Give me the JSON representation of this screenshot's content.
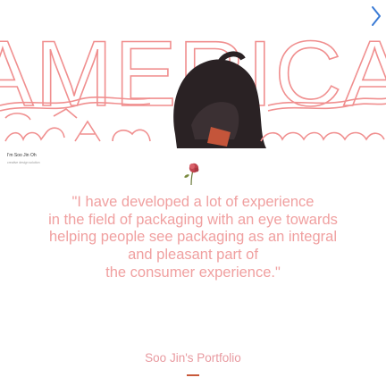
{
  "hero": {
    "title": "AMERICA",
    "nav_icon": "chevron-right-icon"
  },
  "intro": {
    "name": "I'm Soo Jin Oh",
    "tagline": "creative design solution"
  },
  "quote": {
    "lines": [
      "\"I have developed a lot of experience",
      "in the field of packaging with an eye towards",
      "helping people see packaging as an integral",
      "and pleasant part of",
      "the consumer experience.\""
    ]
  },
  "footer": {
    "portfolio_title": "Soo Jin's Portfolio"
  },
  "colors": {
    "line_art": "#f08f8f",
    "quote_text": "#f0a0a0",
    "accent_underline": "#c8593a"
  }
}
